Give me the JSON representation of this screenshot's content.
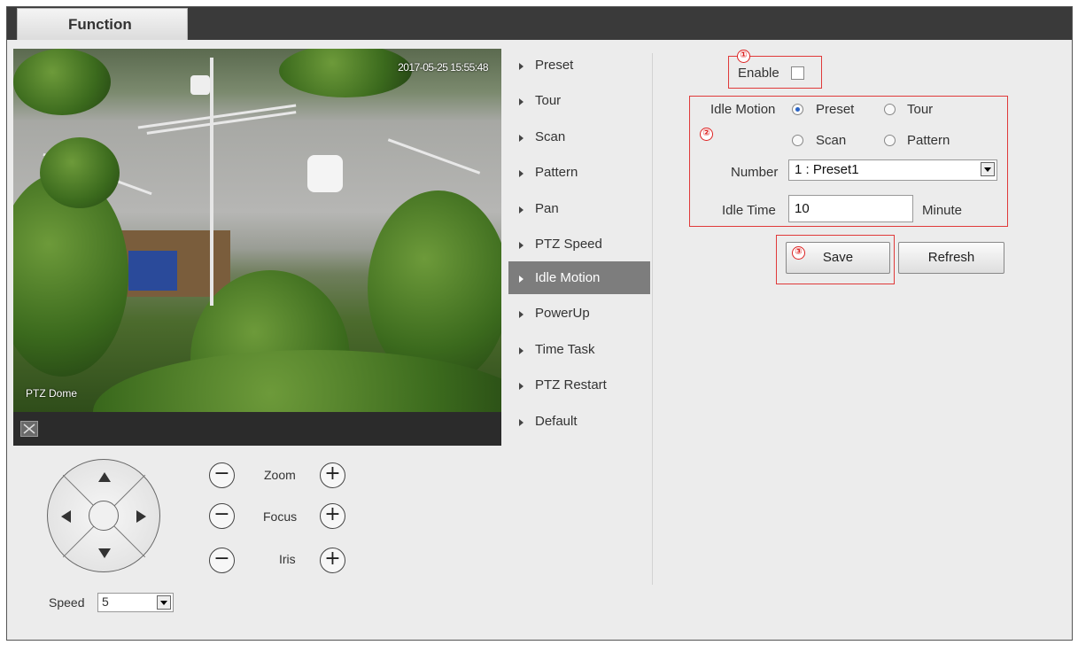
{
  "tab": {
    "label": "Function"
  },
  "video": {
    "timestamp": "2017-05-25 15:55:48",
    "caption": "PTZ Dome"
  },
  "ptz": {
    "zoom_label": "Zoom",
    "focus_label": "Focus",
    "iris_label": "Iris",
    "minus": "−",
    "plus": "+",
    "speed_label": "Speed",
    "speed_value": "5"
  },
  "menu": {
    "items": [
      "Preset",
      "Tour",
      "Scan",
      "Pattern",
      "Pan",
      "PTZ Speed",
      "Idle Motion",
      "PowerUp",
      "Time Task",
      "PTZ Restart",
      "Default"
    ],
    "active": "Idle Motion"
  },
  "form": {
    "badges": [
      "①",
      "②",
      "③"
    ],
    "enable_label": "Enable",
    "enable_checked": false,
    "idle_motion_label": "Idle Motion",
    "options": [
      "Preset",
      "Tour",
      "Scan",
      "Pattern"
    ],
    "selected_option": "Preset",
    "number_label": "Number",
    "number_value": "1 : Preset1",
    "idle_time_label": "Idle Time",
    "idle_time_value": "10",
    "idle_time_unit": "Minute",
    "save_label": "Save",
    "refresh_label": "Refresh"
  },
  "colors": {
    "highlight": "#e03a3a",
    "menu_active": "#7d7d7d",
    "topbar": "#3a3a3a"
  }
}
